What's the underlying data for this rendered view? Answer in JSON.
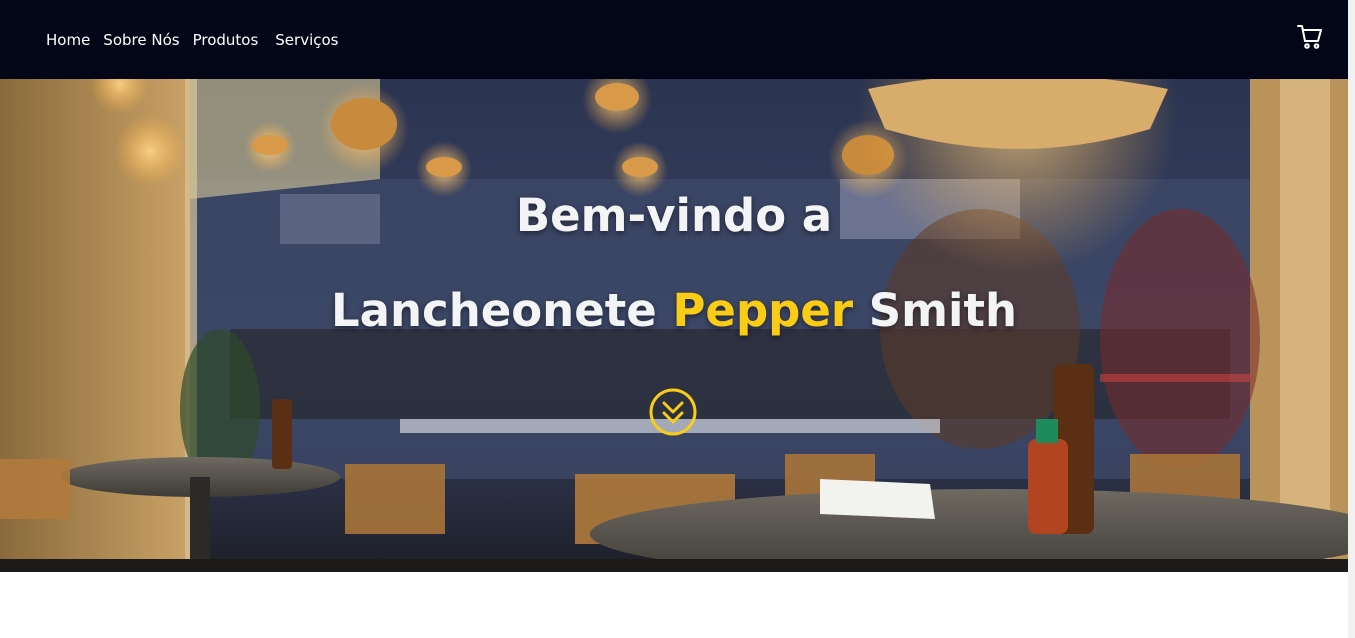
{
  "nav": {
    "items": [
      {
        "label": "Home"
      },
      {
        "label": "Sobre Nós"
      },
      {
        "label": "Produtos"
      },
      {
        "label": "Serviços"
      }
    ],
    "cart_icon": "shopping-cart-icon"
  },
  "hero": {
    "title": "Bem-vindo a",
    "subtitle_prefix": "Lancheonete",
    "subtitle_accent": "Pepper",
    "subtitle_suffix": "Smith",
    "scroll_icon": "chevron-double-down-icon"
  },
  "colors": {
    "navbar": "#020617",
    "accent": "#facc15",
    "text": "#f3f4f6"
  }
}
